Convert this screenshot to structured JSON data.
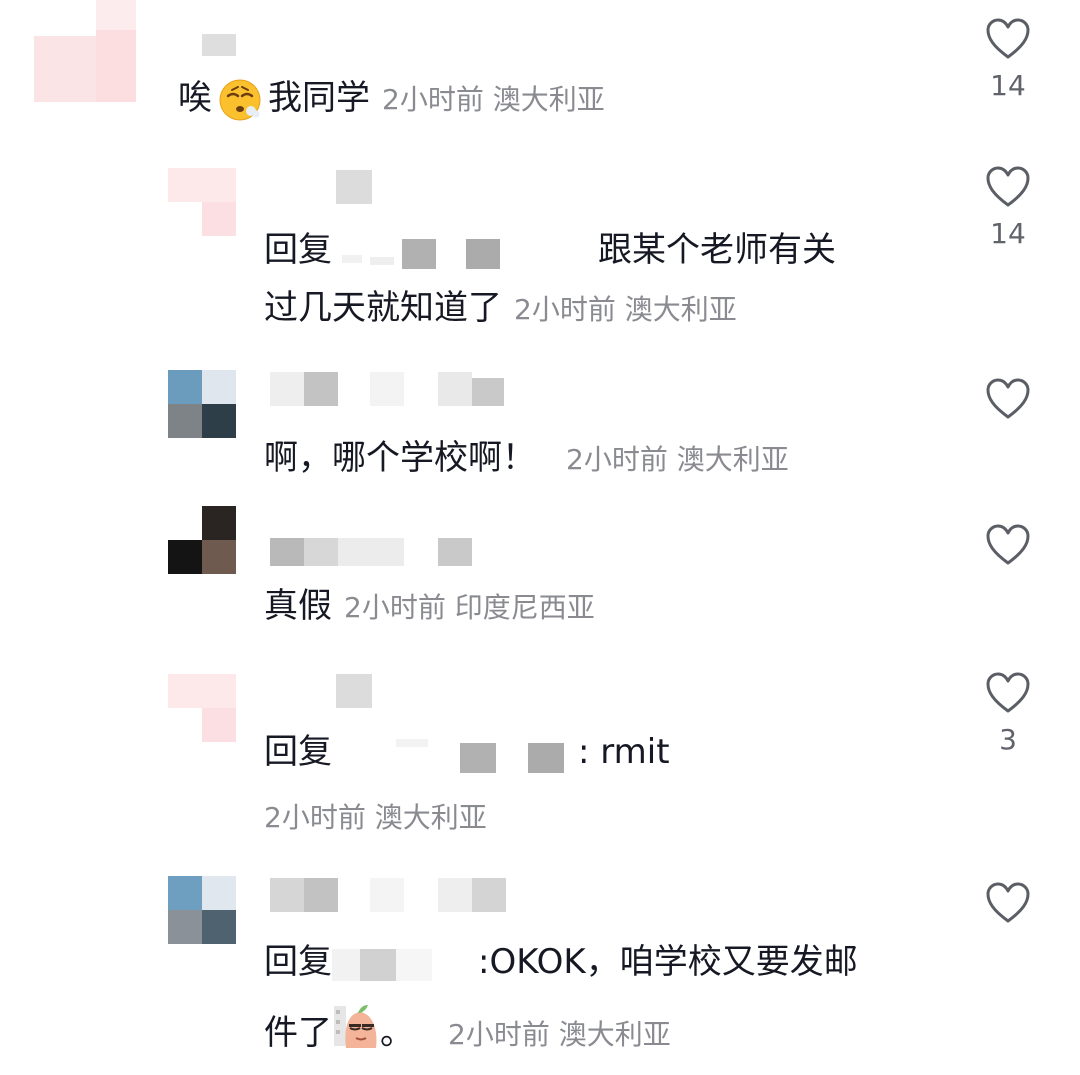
{
  "comments": [
    {
      "text": "唉",
      "text_after_emoji": "我同学",
      "emoji": "exhaling-face-emoji",
      "time": "2小时前",
      "location": "澳大利亚",
      "likes": "14"
    },
    {
      "reply_label": "回复",
      "line1_text": "跟某个老师有关",
      "line2_text": "过几天就知道了",
      "time": "2小时前",
      "location": "澳大利亚",
      "likes": "14"
    },
    {
      "text": "啊，哪个学校啊！",
      "time": "2小时前",
      "location": "澳大利亚",
      "likes": ""
    },
    {
      "text": "真假",
      "time": "2小时前",
      "location": "印度尼西亚",
      "likes": ""
    },
    {
      "reply_label": "回复",
      "text": ": rmit",
      "time": "2小时前",
      "location": "澳大利亚",
      "likes": "3"
    },
    {
      "reply_label": "回复",
      "line1_text": ":OKOK，咱学校又要发邮",
      "line2_text": "件了",
      "line2_suffix": "。",
      "sticker": "sleepy-peach-sticker",
      "time": "2小时前",
      "location": "澳大利亚",
      "likes": ""
    }
  ],
  "colors": {
    "text": "#161823",
    "meta": "#8a8b91",
    "like_count": "#61636b",
    "heart_stroke": "#5c5e66"
  }
}
